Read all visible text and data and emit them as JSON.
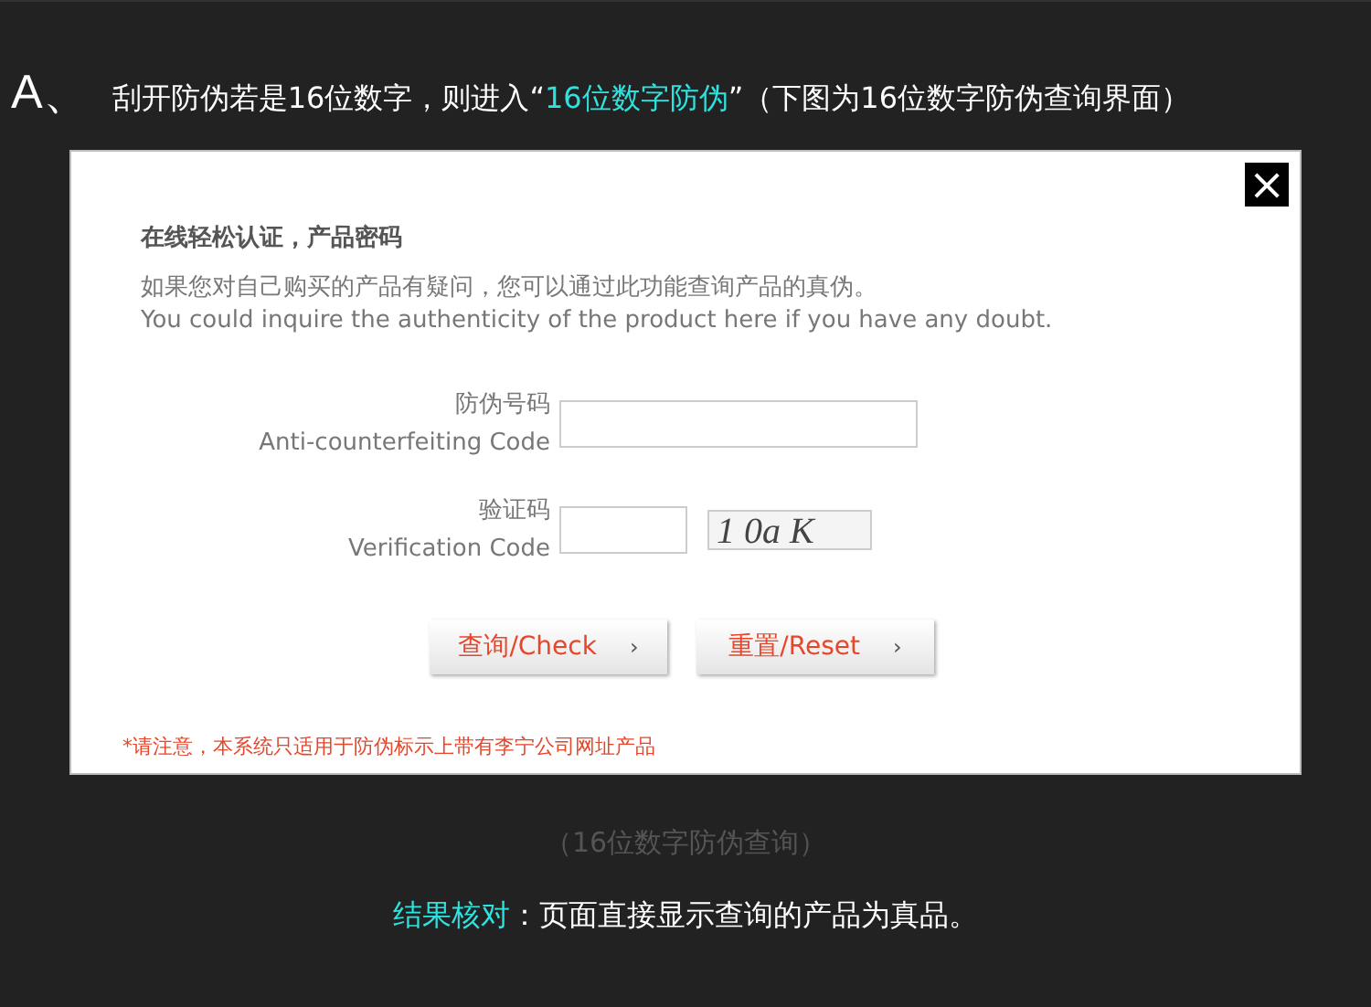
{
  "heading": {
    "marker": "A、",
    "segments": [
      {
        "text": "刮开防伪若是16位数字，则进入“",
        "highlight": false
      },
      {
        "text": "16位数字防伪",
        "highlight": true
      },
      {
        "text": "”（下图为16位数字防伪查询界面）",
        "highlight": false
      }
    ]
  },
  "dialog": {
    "close": "×",
    "title": "在线轻松认证，产品密码",
    "description_cn": "如果您对自己购买的产品有疑问，您可以通过此功能查询产品的真伪。",
    "description_en": "You could inquire the authenticity of the product here if you have any doubt.",
    "fields": [
      {
        "label_cn": "防伪号码",
        "label_en": "Anti-counterfeiting Code",
        "kind": "text"
      },
      {
        "label_cn": "验证码",
        "label_en": "Verification Code",
        "kind": "captcha",
        "captcha": "1 0a K"
      }
    ],
    "buttons": [
      {
        "cn": "查询",
        "en": "/Check",
        "arrow": "›"
      },
      {
        "cn": "重置",
        "en": "/Reset",
        "arrow": "›"
      }
    ],
    "note": "*请注意，本系统只适用于防伪标示上带有李宁公司网址产品"
  },
  "caption": "（16位数字防伪查询）",
  "result": {
    "segments": [
      {
        "text": "结果核对",
        "highlight": true
      },
      {
        "text": "：页面直接显示查询的产品为真品。",
        "highlight": false
      }
    ]
  }
}
